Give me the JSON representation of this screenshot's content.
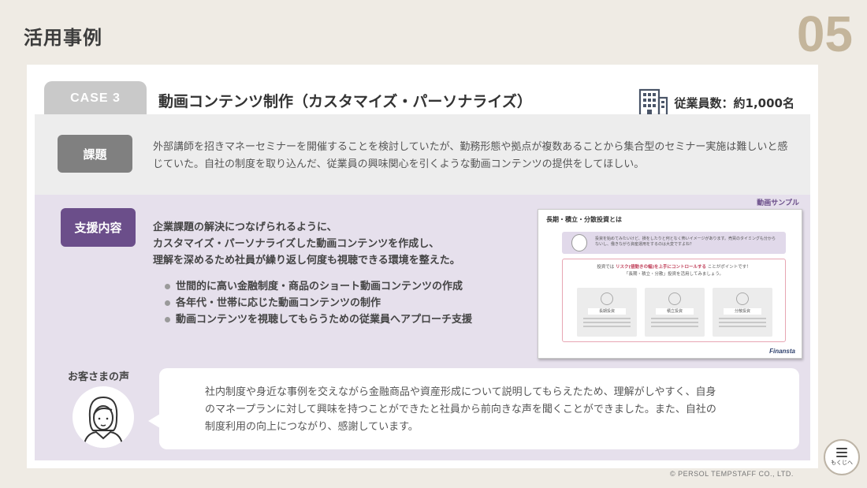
{
  "header": {
    "title": "活用事例",
    "page_number": "05"
  },
  "case": {
    "tab": "CASE 3",
    "title": "動画コンテンツ制作（カスタマイズ・パーソナライズ）",
    "employees_icon": "building-icon",
    "employees": "従業員数：約1,000名"
  },
  "problem": {
    "label": "課題",
    "text": "外部講師を招きマネーセミナーを開催することを検討していたが、勤務形態や拠点が複数あることから集合型のセミナー実施は難しいと感じていた。自社の制度を取り込んだ、従業員の興味関心を引くような動画コンテンツの提供をしてほしい。"
  },
  "support": {
    "label": "支援内容",
    "intro": [
      "企業課題の解決につなげられるように、",
      "カスタマイズ・パーソナライズした動画コンテンツを作成し、",
      "理解を深めるため社員が繰り返し何度も視聴できる環境を整えた。"
    ],
    "bullets": [
      "世間的に高い金融制度・商品のショート動画コンテンツの作成",
      "各年代・世帯に応じた動画コンテンツの制作",
      "動画コンテンツを視聴してもらうための従業員へアプローチ支援"
    ]
  },
  "sample": {
    "label": "動画サンプル",
    "title": "長期・積立・分散投資とは",
    "bubble_text": "投資を始めてみたいけど、損をしたりと何となく怖いイメージがあります。売買のタイミングも分からないし、働きながら資産運用をするのは大変ですよね？",
    "box_head_prefix": "投資では",
    "box_head_highlight": "リスク(値動きの幅)を上手にコントロールする",
    "box_head_suffix": "ことがポイントです！",
    "box_head_line2": "「長期・積立・分散」投資を活用してみましょう。",
    "tiles": [
      "長期投資",
      "積立投資",
      "分散投資"
    ],
    "logo": "Finansta"
  },
  "voice": {
    "label": "お客さまの声",
    "avatar_icon": "customer-avatar-icon",
    "text": [
      "社内制度や身近な事例を交えながら金融商品や資産形成について説明してもらえたため、理解がしやすく、自身",
      "のマネープランに対して興味を持つことができたと社員から前向きな声を聞くことができました。また、自社の",
      "制度利用の向上につながり、感謝しています。"
    ]
  },
  "footer": {
    "copyright": "© PERSOL TEMPSTAFF CO., LTD.",
    "toc_label": "もくじへ"
  },
  "colors": {
    "background": "#efebe4",
    "page_number": "#c4b59b",
    "problem_band": "#ededed",
    "problem_label": "#808080",
    "support_band": "#e6e0ec",
    "support_label": "#6b4e8a",
    "case_tab": "#c9c9c9"
  }
}
